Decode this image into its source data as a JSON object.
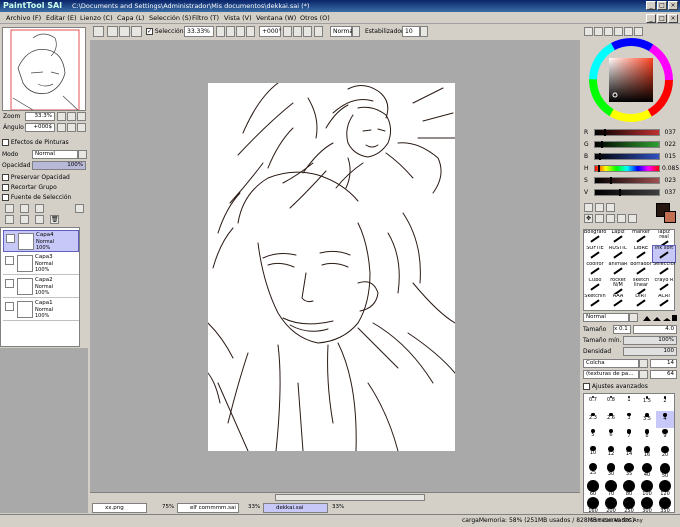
{
  "title_bar": {
    "logo": "PaintTool SAI",
    "path": "C:\\Documents and Settings\\Administrador\\Mis documentos\\dekkai.sai (*)",
    "buttons": [
      "_",
      "□",
      "×"
    ]
  },
  "menu": [
    "Archivo (F)",
    "Editar (E)",
    "Lienzo (C)",
    "Capa (L)",
    "Selección (S)",
    "Filtro (T)",
    "Vista (V)",
    "Ventana (W)",
    "Otros (O)"
  ],
  "toolbar": {
    "selection_label": "Selección",
    "zoom": "33.33%",
    "rotation": "+000°",
    "mode": "Normal",
    "stabilizer_label": "Estabilizador",
    "stabilizer_value": "10"
  },
  "navigator": {
    "zoom_label": "Zoom",
    "zoom_value": "33.3%",
    "angle_label": "Ángulo",
    "angle_value": "+000$"
  },
  "layer_panel": {
    "effects": "Efectos de Pinturas",
    "mode_label": "Modo",
    "mode_value": "Normal",
    "opacity_label": "Opacidad",
    "opacity_value": "100%",
    "opacity_fraction": 1.0,
    "preserve_opacity": "Preservar Opacidad",
    "clip_group": "Recortar Grupo",
    "selection_source": "Fuente de Selección",
    "layers": [
      {
        "name": "Capa4",
        "mode": "Normal",
        "opacity": "100%",
        "selected": true
      },
      {
        "name": "Capa3",
        "mode": "Normal",
        "opacity": "100%",
        "selected": false
      },
      {
        "name": "Capa2",
        "mode": "Normal",
        "opacity": "100%",
        "selected": false
      },
      {
        "name": "Capa1",
        "mode": "Normal",
        "opacity": "100%",
        "selected": false
      }
    ]
  },
  "color": {
    "current_color": "#25160f",
    "secondary_color": "#c07050",
    "sliders": [
      {
        "label": "R",
        "value": "037",
        "fraction": 0.145,
        "color": "#c03030"
      },
      {
        "label": "G",
        "value": "022",
        "fraction": 0.086,
        "color": "#30a030"
      },
      {
        "label": "B",
        "value": "015",
        "fraction": 0.059,
        "color": "#3050c0"
      },
      {
        "label": "H",
        "value": "0.085",
        "fraction": 0.05,
        "color": "#e04040"
      },
      {
        "label": "S",
        "value": "023",
        "fraction": 0.23,
        "color": "#a05050"
      },
      {
        "label": "V",
        "value": "037",
        "fraction": 0.37,
        "color": "#404040"
      }
    ]
  },
  "brushes": [
    "Bolígrafo",
    "Lapiz",
    "marker",
    "lapiz real",
    "SOFTIE",
    "RUSTIC",
    "LIBRE",
    "ink soft",
    "coolfor",
    "animaR",
    "borrador",
    "Selección",
    "Cubo",
    "rocket N/M",
    "sketch linear",
    "crayo R",
    "Sketchin",
    "AAA",
    "DIRT",
    "ACRI"
  ],
  "brush_settings": {
    "mode": "Normal",
    "size_label": "Tamaño",
    "size_mult": "x 0.1",
    "size_value": "4.0",
    "min_size_label": "Tamaño mín.",
    "min_size_value": "100%",
    "density_label": "Densidad",
    "density_value": "100",
    "texture1": "Colcha",
    "texture1_value": "14",
    "texture2": "(texturas de pa...",
    "texture2_value": "64",
    "advanced": "Ajustes avanzados"
  },
  "brush_sizes": [
    "0.7",
    "0.8",
    "1",
    "1.5",
    "2",
    "2.3",
    "2.6",
    "3",
    "3.5",
    "4",
    "5",
    "6",
    "7",
    "8",
    "9",
    "10",
    "12",
    "14",
    "16",
    "20",
    "25",
    "30",
    "35",
    "40",
    "50",
    "60",
    "70",
    "80",
    "100",
    "120",
    "160",
    "200",
    "250",
    "300",
    "350"
  ],
  "documents": [
    {
      "name": "xx.png",
      "zoom": "75%"
    },
    {
      "name": "elf commmm.sai",
      "zoom": "33%"
    },
    {
      "name": "dekkai.sai",
      "zoom": "33%",
      "selected": true
    }
  ],
  "status": "cargaMemoria: 58% (251MB usados / 828MB reservados)",
  "status_icons": [
    "Shift",
    "Ctrl",
    "Alt",
    "SPC",
    "Any"
  ]
}
